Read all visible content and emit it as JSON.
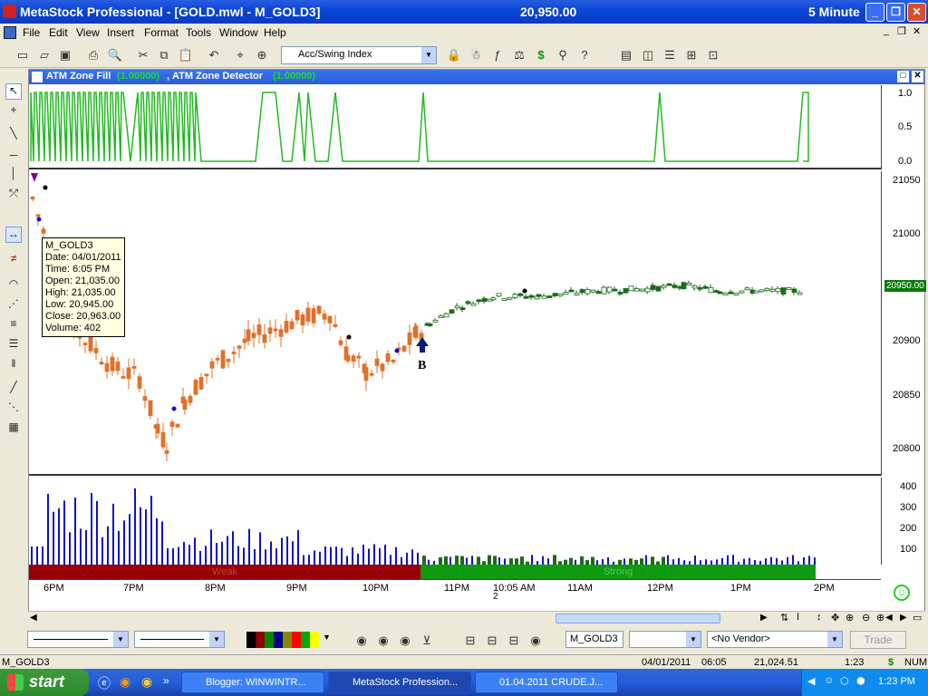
{
  "window": {
    "title": "MetaStock Professional - [GOLD.mwl - M_GOLD3]",
    "price": "20,950.00",
    "interval": "5 Minute",
    "minimize": "_",
    "restore": "❐",
    "close": "✕"
  },
  "menu": [
    "File",
    "Edit",
    "View",
    "Insert",
    "Format",
    "Tools",
    "Window",
    "Help"
  ],
  "toolbar": {
    "indicator_combo": "Acc/Swing Index"
  },
  "chart": {
    "header_title": "ATM Zone Fill",
    "header_value1": "(1.00000)",
    "header_sep": ", ",
    "header_title2": "ATM Zone Detector",
    "header_value2": "(1.00000)",
    "top_pane_y_labels": [
      "1.0",
      "0.5",
      "0.0"
    ],
    "price_y_labels": [
      "21050",
      "21000",
      "20950",
      "20900",
      "20850",
      "20800"
    ],
    "price_marker": "20950.00",
    "volume_y_labels": [
      "400",
      "300",
      "200",
      "100"
    ],
    "band_left_label": "Weak",
    "band_right_label": "Strong",
    "x_labels": [
      "6PM",
      "7PM",
      "8PM",
      "9PM",
      "10PM",
      "11PM",
      "10:05 AM",
      "11AM",
      "12PM",
      "1PM",
      "2PM"
    ],
    "x_sub_label": "2",
    "buy_label": "B"
  },
  "tooltip": {
    "lines": [
      "M_GOLD3",
      "Date: 04/01/2011",
      "Time: 6:05 PM",
      "Open: 21,035.00",
      "High: 21,035.00",
      "Low: 20,945.00",
      "Close: 20,963.00",
      "Volume: 402"
    ]
  },
  "bottom_toolbar": {
    "symbol_field": "M_GOLD3",
    "vendor_combo": "<No Vendor>",
    "trade_button": "Trade"
  },
  "status": {
    "symbol": "M_GOLD3",
    "date": "04/01/2011",
    "time": "06:05",
    "value": "21,024.51",
    "ratio": "1:23",
    "dollar": "$",
    "num": "NUM"
  },
  "taskbar": {
    "start": "start",
    "tasks": [
      "Blogger: WINWINTR...",
      "MetaStock Profession...",
      "01.04.2011 CRUDE.J..."
    ],
    "clock": "1:23 PM"
  },
  "colors": {
    "bear": "#e0702a",
    "bull": "#1a6b1a",
    "zone": "#22bb22",
    "volume": "#1010cc",
    "weak": "#990000",
    "strong": "#0f9a0f"
  }
}
